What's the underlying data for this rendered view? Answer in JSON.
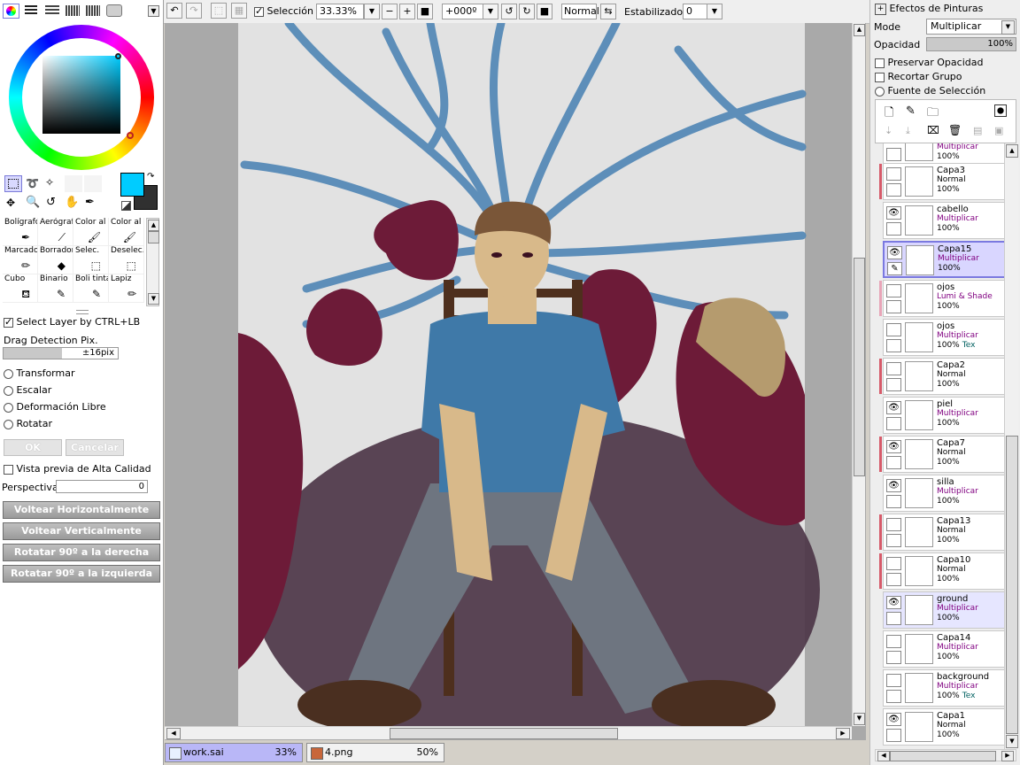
{
  "left_panel": {
    "view_tabs": [
      "color-wheel",
      "rgb",
      "hsv",
      "swatch",
      "scratch"
    ],
    "tools": [
      {
        "label": "Bolígrafo",
        "icon": "pen-icon"
      },
      {
        "label": "Aerógraf",
        "icon": "airbrush-icon"
      },
      {
        "label": "Color al",
        "icon": "watercolor-icon"
      },
      {
        "label": "Color al",
        "icon": "watercolor2-icon"
      },
      {
        "label": "Marcado",
        "icon": "marker-icon"
      },
      {
        "label": "Borrador",
        "icon": "eraser-icon"
      },
      {
        "label": "Selec.",
        "icon": "select-pen-icon"
      },
      {
        "label": "Deselec.",
        "icon": "deselect-pen-icon"
      },
      {
        "label": "Cubo",
        "icon": "bucket-icon"
      },
      {
        "label": "Binario",
        "icon": "binary-pen-icon"
      },
      {
        "label": "Boli tinta",
        "icon": "ink-pen-icon"
      },
      {
        "label": "Lapiz",
        "icon": "pencil-icon"
      }
    ],
    "select_layer_label": "Select Layer by CTRL+LB",
    "drag_detection_label": "Drag Detection Pix.",
    "drag_detection_value": "±16pix",
    "radio_options": [
      "Transformar",
      "Escalar",
      "Deformación Libre",
      "Rotatar"
    ],
    "ok_label": "OK",
    "cancel_label": "Cancelar",
    "hq_preview_label": "Vista previa de Alta Calidad",
    "perspective_label": "Perspectiva",
    "perspective_value": "0",
    "flip_h_label": "Voltear Horizontalmente",
    "flip_v_label": "Voltear Verticalmente",
    "rotate_right_label": "Rotatar 90º a la derecha",
    "rotate_left_label": "Rotatar 90º a la izquierda",
    "primary_color": "#00ccff",
    "secondary_color": "#303030"
  },
  "toolbar": {
    "selection_label": "Selección",
    "zoom_value": "33.33%",
    "rotation_value": "+000º",
    "blend_mode": "Normal",
    "stabilizer_label": "Estabilizador",
    "stabilizer_value": "0"
  },
  "right_panel": {
    "effects_label": "Efectos de Pinturas",
    "mode_label": "Mode",
    "mode_value": "Multiplicar",
    "opacity_label": "Opacidad",
    "opacity_value": "100%",
    "opacity_fraction": 1.0,
    "options": [
      {
        "label": "Preservar Opacidad",
        "type": "check"
      },
      {
        "label": "Recortar Grupo",
        "type": "check"
      },
      {
        "label": "Fuente de Selección",
        "type": "radio"
      }
    ],
    "partial_top_layer": {
      "mode": "Multiplicar",
      "opacity": "100%"
    },
    "layers": [
      {
        "name": "Capa3",
        "mode": "Normal",
        "opacity": "100%",
        "visible": false,
        "tex": "",
        "mark": "red",
        "state": ""
      },
      {
        "name": "cabello",
        "mode": "Multiplicar",
        "opacity": "100%",
        "visible": true,
        "tex": "",
        "mark": "",
        "state": ""
      },
      {
        "name": "Capa15",
        "mode": "Multiplicar",
        "opacity": "100%",
        "visible": true,
        "tex": "",
        "mark": "",
        "state": "sel"
      },
      {
        "name": "ojos",
        "mode": "Lumi & Shade",
        "opacity": "100%",
        "visible": false,
        "tex": "",
        "mark": "pink",
        "state": ""
      },
      {
        "name": "ojos",
        "mode": "Multiplicar",
        "opacity": "100%",
        "visible": false,
        "tex": "Tex",
        "mark": "",
        "state": ""
      },
      {
        "name": "Capa2",
        "mode": "Normal",
        "opacity": "100%",
        "visible": false,
        "tex": "",
        "mark": "red",
        "state": ""
      },
      {
        "name": "piel",
        "mode": "Multiplicar",
        "opacity": "100%",
        "visible": true,
        "tex": "",
        "mark": "",
        "state": ""
      },
      {
        "name": "Capa7",
        "mode": "Normal",
        "opacity": "100%",
        "visible": true,
        "tex": "",
        "mark": "red",
        "state": ""
      },
      {
        "name": "silla",
        "mode": "Multiplicar",
        "opacity": "100%",
        "visible": true,
        "tex": "",
        "mark": "",
        "state": ""
      },
      {
        "name": "Capa13",
        "mode": "Normal",
        "opacity": "100%",
        "visible": false,
        "tex": "",
        "mark": "red",
        "state": ""
      },
      {
        "name": "Capa10",
        "mode": "Normal",
        "opacity": "100%",
        "visible": false,
        "tex": "",
        "mark": "red",
        "state": ""
      },
      {
        "name": "ground",
        "mode": "Multiplicar",
        "opacity": "100%",
        "visible": true,
        "tex": "",
        "mark": "",
        "state": "hl"
      },
      {
        "name": "Capa14",
        "mode": "Multiplicar",
        "opacity": "100%",
        "visible": false,
        "tex": "",
        "mark": "",
        "state": ""
      },
      {
        "name": "background",
        "mode": "Multiplicar",
        "opacity": "100%",
        "visible": false,
        "tex": "Tex",
        "mark": "",
        "state": ""
      },
      {
        "name": "Capa1",
        "mode": "Normal",
        "opacity": "100%",
        "visible": true,
        "tex": "",
        "mark": "",
        "state": ""
      }
    ]
  },
  "tabs": [
    {
      "name": "work.sai",
      "zoom": "33%",
      "active": true
    },
    {
      "name": "4.png",
      "zoom": "50%",
      "active": false
    }
  ]
}
